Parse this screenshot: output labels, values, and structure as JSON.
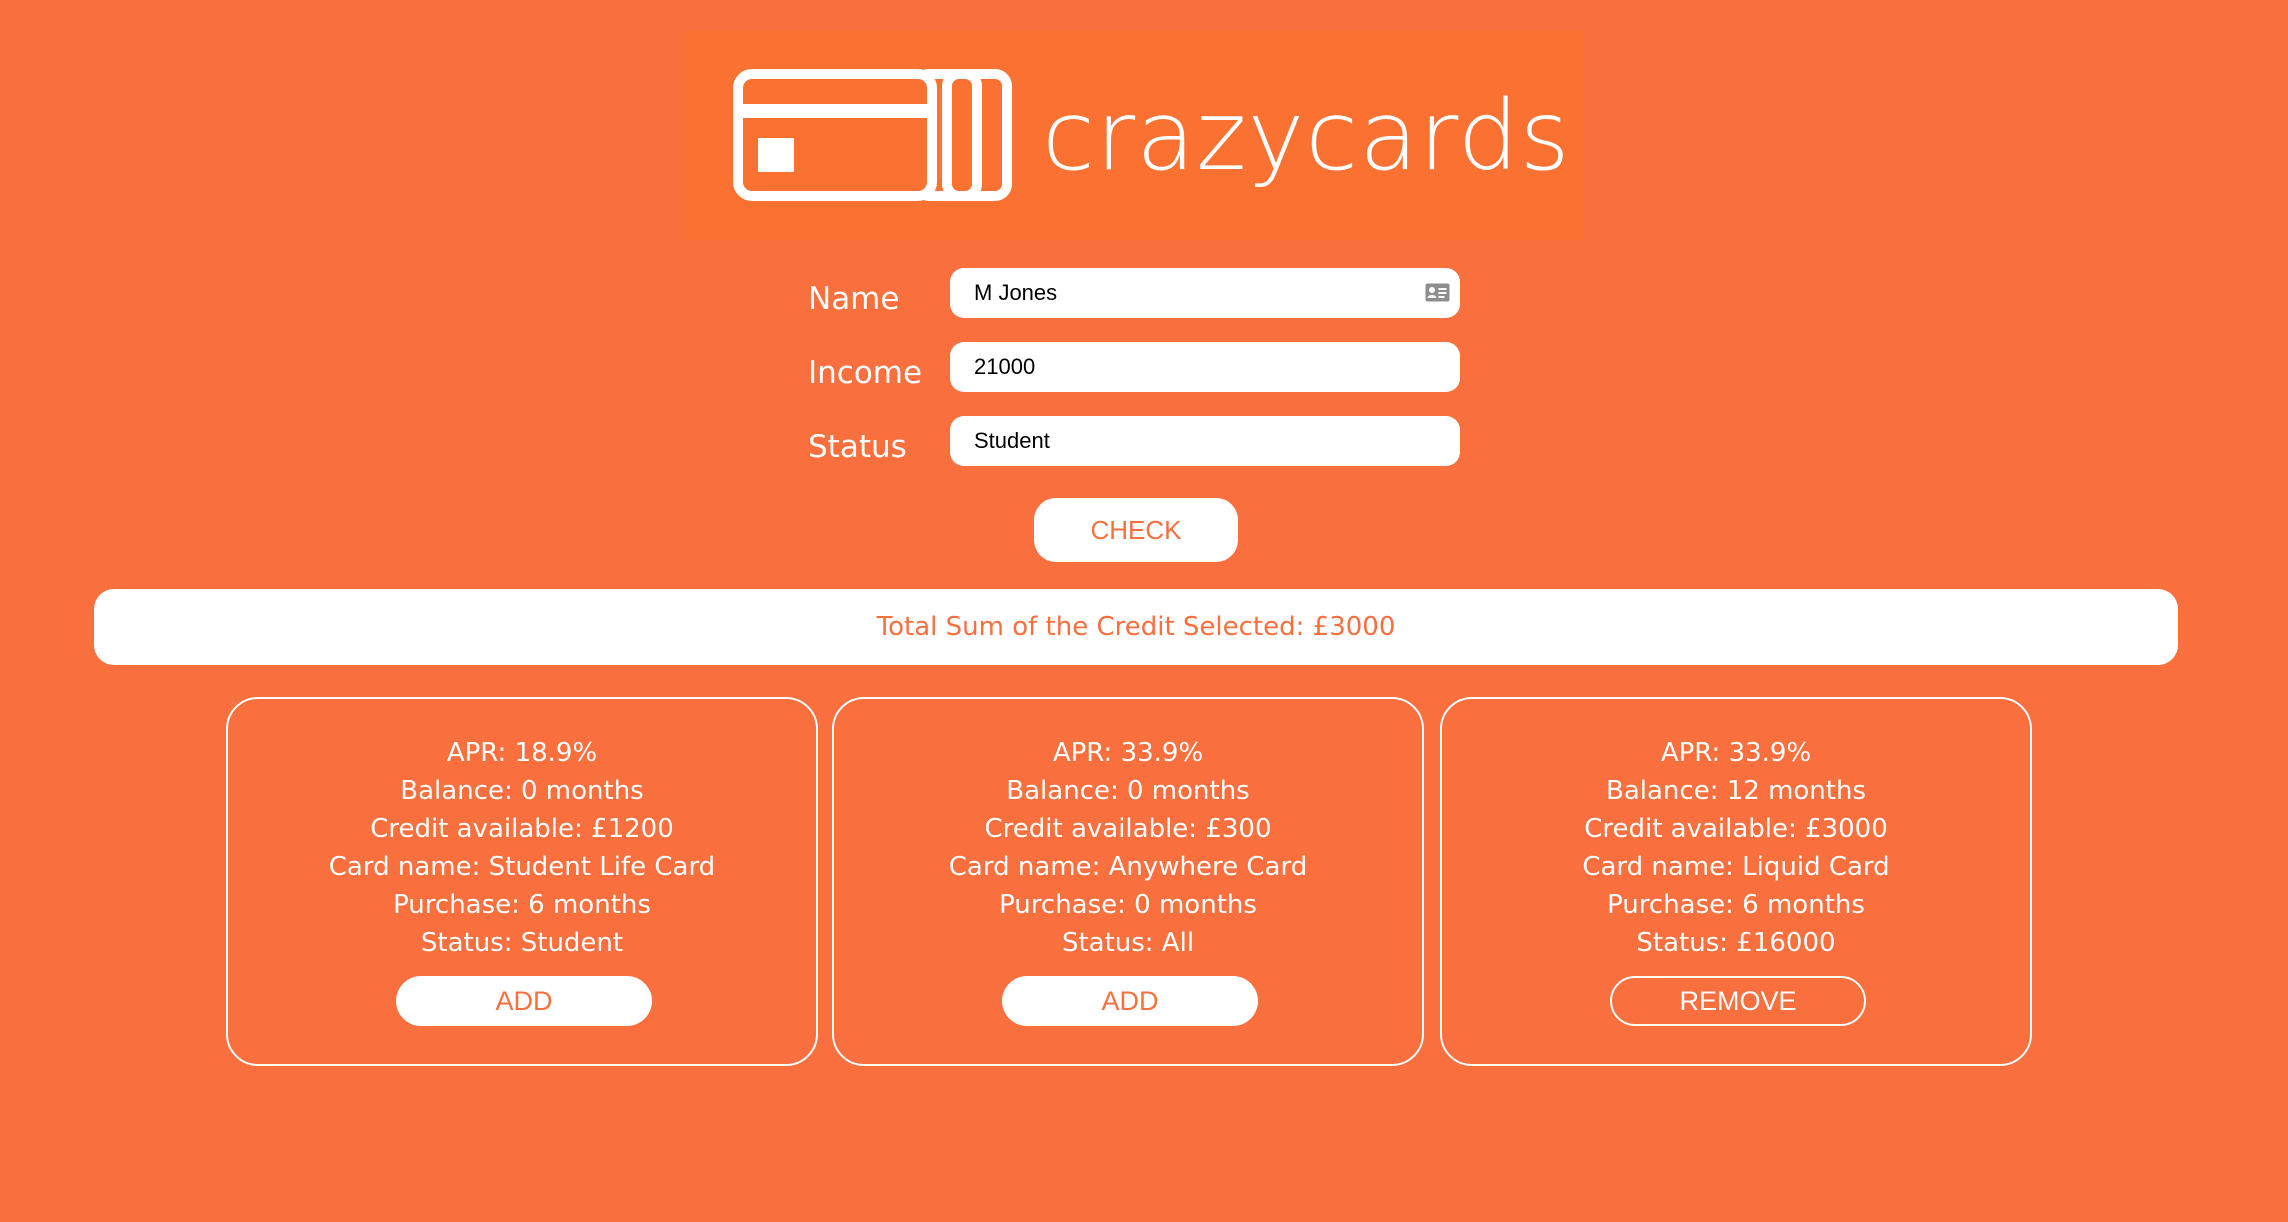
{
  "brand": {
    "name": "crazycards"
  },
  "form": {
    "name_label": "Name",
    "name_value": "M Jones",
    "income_label": "Income",
    "income_value": "21000",
    "status_label": "Status",
    "status_value": "Student",
    "check_label": "CHECK"
  },
  "total": {
    "text": "Total Sum of the Credit Selected: £3000"
  },
  "cards": [
    {
      "apr": "APR: 18.9%",
      "balance": "Balance: 0 months",
      "credit": "Credit available: £1200",
      "card_name": "Card name: Student Life Card",
      "purchase": "Purchase: 6 months",
      "status": "Status: Student",
      "button": "ADD"
    },
    {
      "apr": "APR: 33.9%",
      "balance": "Balance: 0 months",
      "credit": "Credit available: £300",
      "card_name": "Card name: Anywhere Card",
      "purchase": "Purchase: 0 months",
      "status": "Status: All",
      "button": "ADD"
    },
    {
      "apr": "APR: 33.9%",
      "balance": "Balance: 12 months",
      "credit": "Credit available: £3000",
      "card_name": "Card name: Liquid Card",
      "purchase": "Purchase: 6 months",
      "status": "Status: £16000",
      "button": "REMOVE"
    }
  ],
  "colors": {
    "background": "#f96f3e",
    "logo_background": "#fa7132",
    "foreground": "#ffffff"
  },
  "icons": {
    "logo": "credit-cards-icon",
    "name_field": "contact-card-icon"
  }
}
